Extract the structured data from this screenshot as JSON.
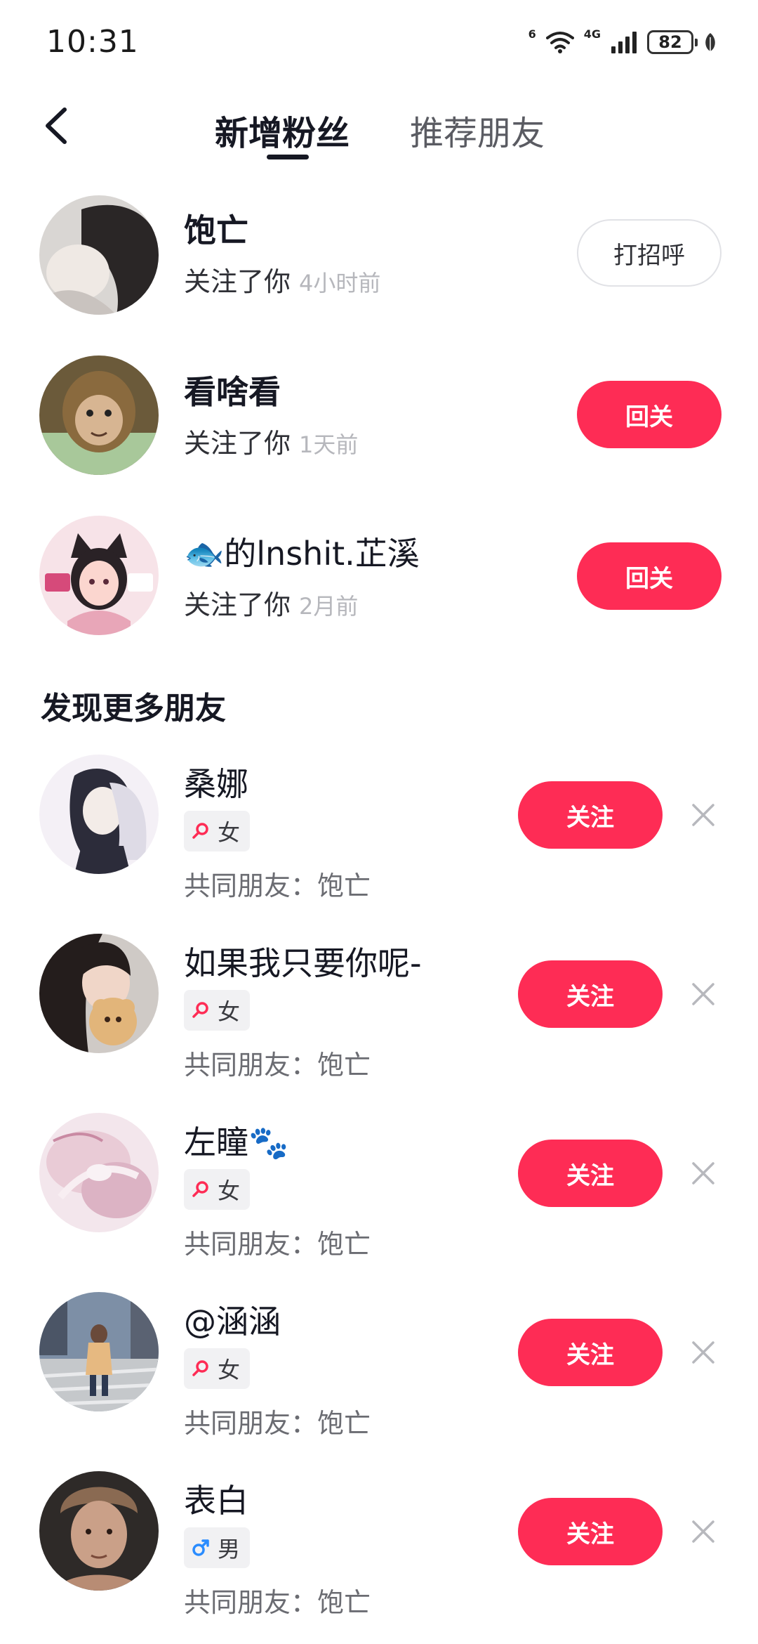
{
  "status_bar": {
    "time": "10:31",
    "wifi_label": "6",
    "signal_label": "4G",
    "battery": "82"
  },
  "tabs": [
    {
      "label": "新增粉丝",
      "active": true
    },
    {
      "label": "推荐朋友",
      "active": false
    }
  ],
  "new_followers": [
    {
      "name": "饱亡",
      "status": "关注了你",
      "time": "4小时前",
      "action": "打招呼"
    },
    {
      "name": "看啥看",
      "status": "关注了你",
      "time": "1天前",
      "action": "回关"
    },
    {
      "name": "🐟的lnshit.芷溪",
      "status": "关注了你",
      "time": "2月前",
      "action": "回关"
    }
  ],
  "discover": {
    "title": "发现更多朋友",
    "items": [
      {
        "name": "桑娜",
        "gender": "女",
        "mutual": "共同朋友：饱亡",
        "action": "关注"
      },
      {
        "name": "如果我只要你呢-",
        "gender": "女",
        "mutual": "共同朋友：饱亡",
        "action": "关注"
      },
      {
        "name": "左瞳🐾",
        "gender": "女",
        "mutual": "共同朋友：饱亡",
        "action": "关注"
      },
      {
        "name": "@涵涵",
        "gender": "女",
        "mutual": "共同朋友：饱亡",
        "action": "关注"
      },
      {
        "name": "表白",
        "gender": "男",
        "mutual": "共同朋友：饱亡",
        "action": "关注"
      }
    ]
  },
  "colors": {
    "accent": "#fe2c55",
    "female": "#fe2c55",
    "male": "#2a8cff"
  }
}
